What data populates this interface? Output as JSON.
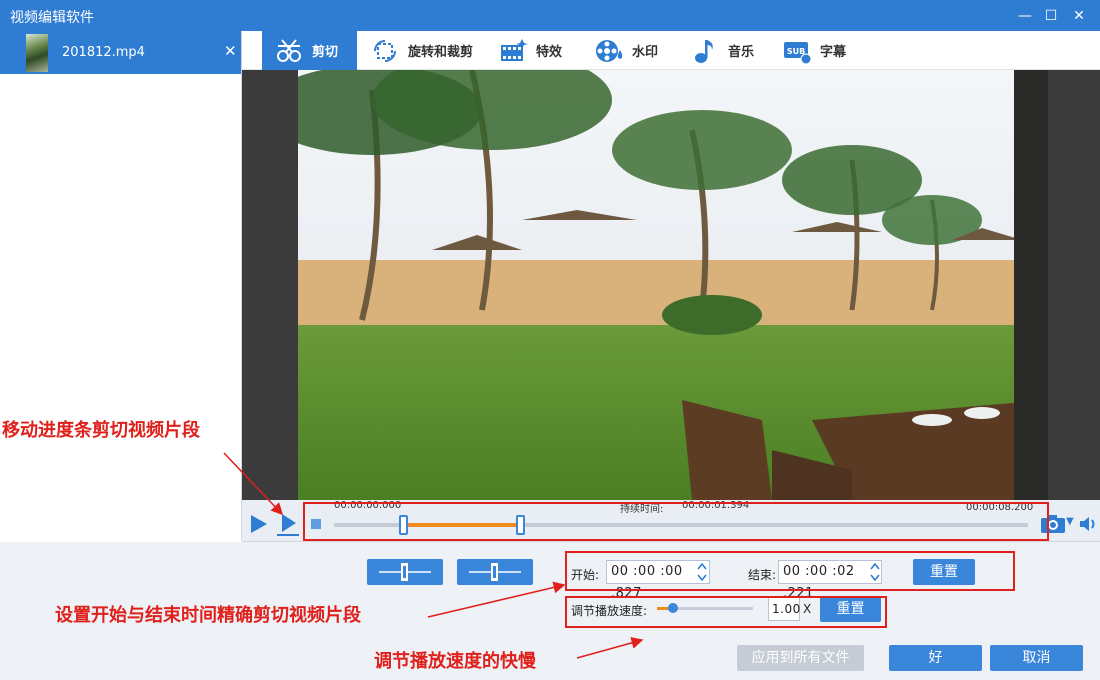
{
  "window": {
    "title": "视频编辑软件"
  },
  "file": {
    "name": "201812.mp4"
  },
  "tabs": [
    {
      "label": "剪切",
      "icon": "scissors-icon"
    },
    {
      "label": "旋转和裁剪",
      "icon": "rotate-crop-icon"
    },
    {
      "label": "特效",
      "icon": "film-effects-icon"
    },
    {
      "label": "水印",
      "icon": "watermark-icon"
    },
    {
      "label": "音乐",
      "icon": "music-note-icon"
    },
    {
      "label": "字幕",
      "icon": "subtitle-icon"
    }
  ],
  "timeline": {
    "start_time": "00:00:00.000",
    "end_time": "00:00:08.200",
    "duration_label": "持续时间:",
    "duration_value": "00:00:01.394",
    "selection_start_fraction": 0.101,
    "selection_end_fraction": 0.27
  },
  "trim": {
    "start_label": "开始:",
    "start_value": "00 :00 :00 .827",
    "end_label": "结束:",
    "end_value": "00 :00 :02 .221",
    "reset_label": "重置"
  },
  "speed": {
    "label": "调节播放速度:",
    "value": "1.00",
    "unit": "X",
    "reset_label": "重置",
    "level_fraction": 0.17
  },
  "actions": {
    "apply_all": "应用到所有文件",
    "ok": "好",
    "cancel": "取消"
  },
  "annotations": {
    "move_progress": "移动进度条剪切视频片段",
    "set_times": "设置开始与结束时间精确剪切视频片段",
    "adjust_speed": "调节播放速度的快慢"
  },
  "colors": {
    "accent": "#2f7cd3",
    "annotation": "#e0201b",
    "selection": "#f08c1e"
  }
}
